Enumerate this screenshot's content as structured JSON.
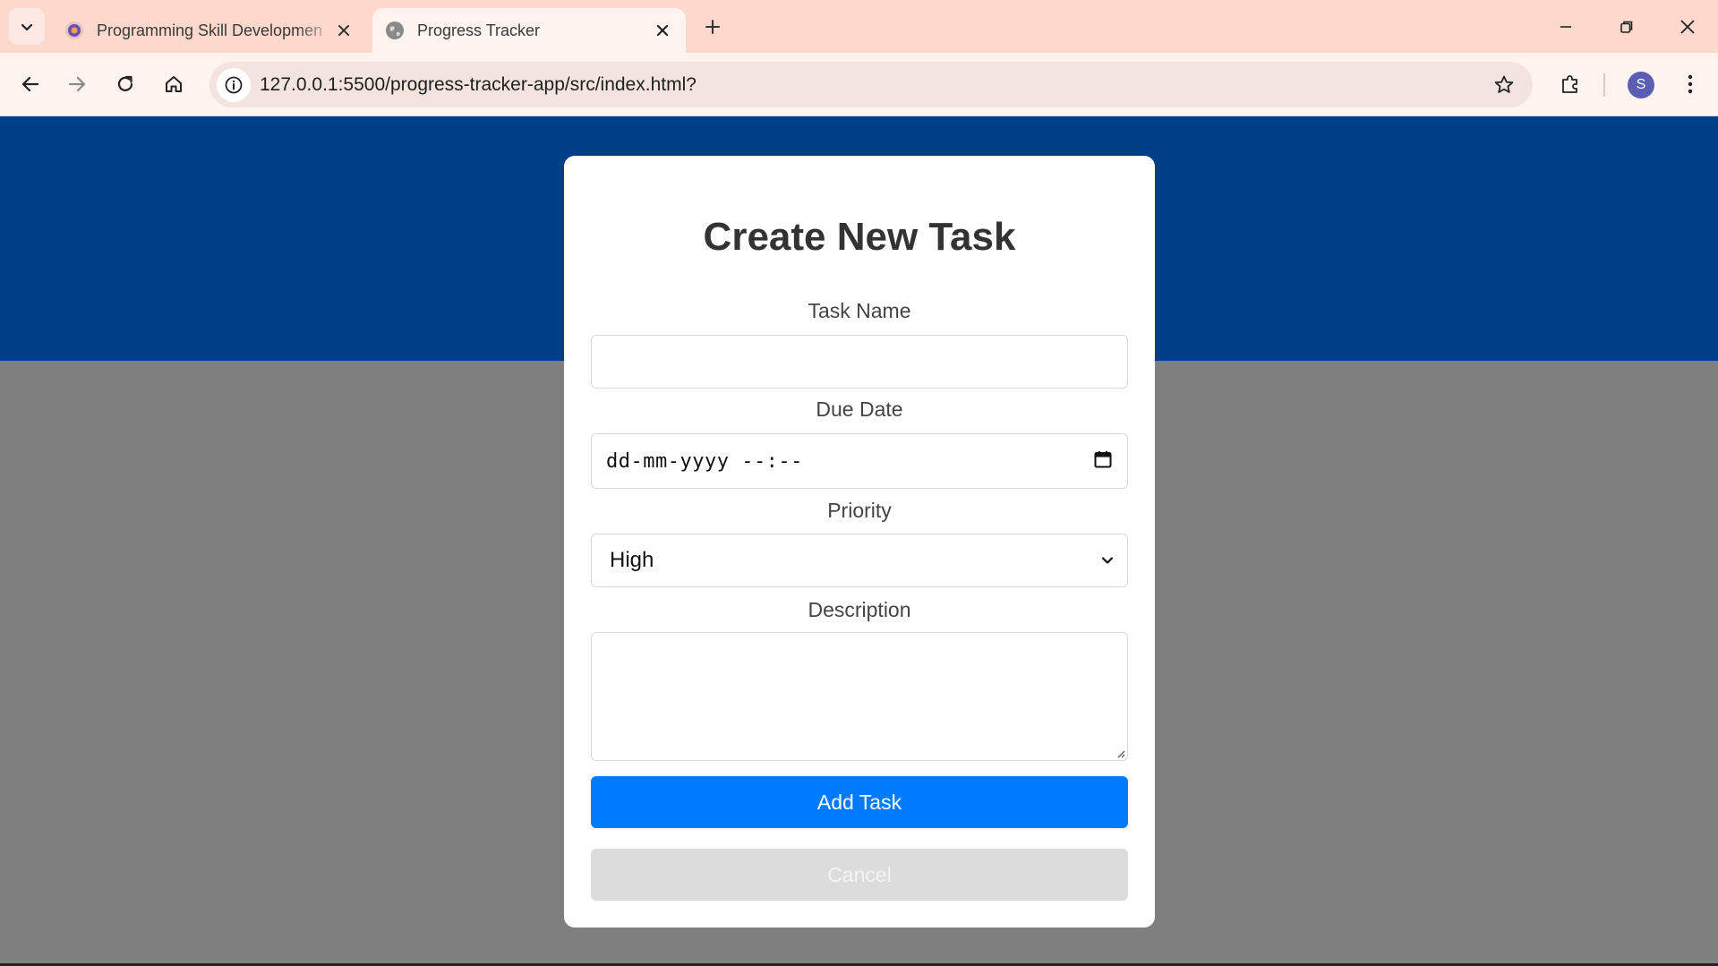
{
  "browser": {
    "tabs": [
      {
        "title": "Programming Skill Developmen",
        "active": false,
        "icon": "app-favicon"
      },
      {
        "title": "Progress Tracker",
        "active": true,
        "icon": "globe-icon"
      }
    ],
    "url": "127.0.0.1:5500/progress-tracker-app/src/index.html?",
    "profile_initial": "S",
    "colors": {
      "frame": "#fdd8cc",
      "toolbar": "#fff3ef",
      "avatar": "#5a5fb3"
    }
  },
  "page": {
    "colors": {
      "header": "#003f87",
      "backdrop": "#7f7f80",
      "primary_button": "#007bff",
      "cancel_button": "#dcdcdc"
    }
  },
  "modal": {
    "title": "Create New Task",
    "task_name": {
      "label": "Task Name",
      "value": ""
    },
    "due_date": {
      "label": "Due Date",
      "placeholder": "dd-mm-yyyy --:--"
    },
    "priority": {
      "label": "Priority",
      "selected": "High"
    },
    "description": {
      "label": "Description",
      "value": ""
    },
    "add_button": "Add Task",
    "cancel_button": "Cancel"
  }
}
